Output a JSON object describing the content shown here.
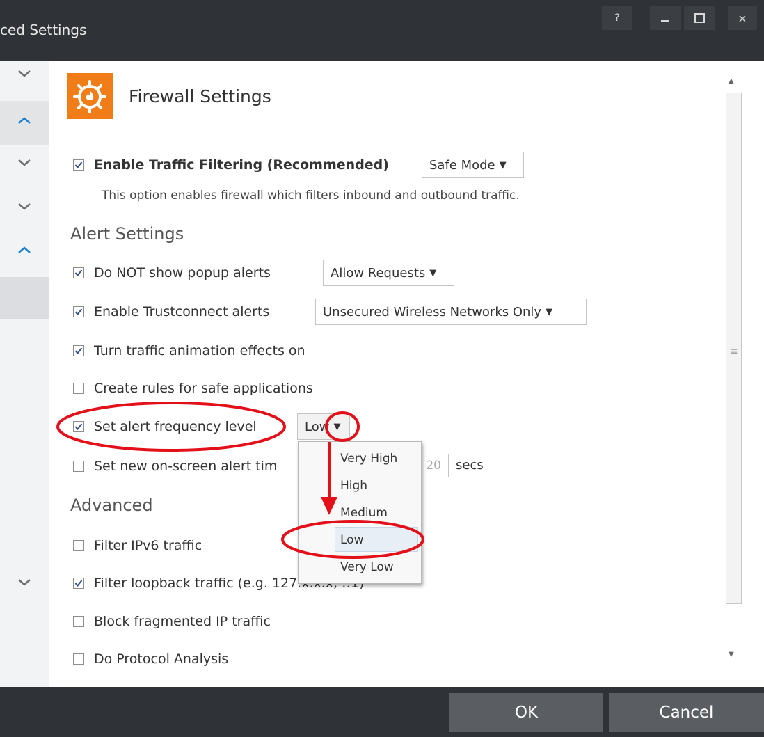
{
  "window": {
    "title": "ced Settings",
    "help_label": "?",
    "close_label": "×"
  },
  "panel": {
    "title": "Firewall Settings"
  },
  "traffic_filtering": {
    "label": "Enable Traffic Filtering (Recommended)",
    "checked": true,
    "mode_value": "Safe Mode",
    "description": "This option enables firewall which filters inbound and outbound traffic."
  },
  "alert_settings": {
    "heading": "Alert Settings",
    "popup_alerts": {
      "label": "Do NOT show popup alerts",
      "checked": true,
      "value": "Allow Requests"
    },
    "trustconnect": {
      "label": "Enable Trustconnect alerts",
      "checked": true,
      "value": "Unsecured Wireless Networks Only"
    },
    "animation": {
      "label": "Turn traffic animation effects on",
      "checked": true
    },
    "safe_rules": {
      "label": "Create rules for safe applications",
      "checked": false
    },
    "frequency": {
      "label": "Set alert frequency level",
      "checked": true,
      "value": "Low"
    },
    "timeout": {
      "label": "Set new on-screen alert tim",
      "checked": false,
      "value": "20",
      "unit": "secs"
    }
  },
  "frequency_menu": {
    "options": [
      "Very High",
      "High",
      "Medium",
      "Low",
      "Very Low"
    ],
    "highlighted": "Low"
  },
  "advanced": {
    "heading": "Advanced",
    "ipv6": {
      "label": "Filter IPv6 traffic",
      "checked": false
    },
    "loopback": {
      "label": "Filter loopback traffic (e.g. 127.x.x.x, ::1)",
      "checked": true
    },
    "fragmented": {
      "label": "Block fragmented IP traffic",
      "checked": false
    },
    "protocol": {
      "label": "Do Protocol Analysis",
      "checked": false
    }
  },
  "footer": {
    "ok_label": "OK",
    "cancel_label": "Cancel"
  },
  "colors": {
    "titlebar": "#2f3236",
    "accent_orange": "#f07d18",
    "annotation_red": "#e3101a",
    "chevron_blue": "#1a7fd0",
    "button_bg": "#5a5e63"
  },
  "icons": {
    "firewall": "flame-shield-icon",
    "check": "check-icon",
    "nav_up": "chevron-up-icon",
    "nav_down": "chevron-down-icon"
  }
}
